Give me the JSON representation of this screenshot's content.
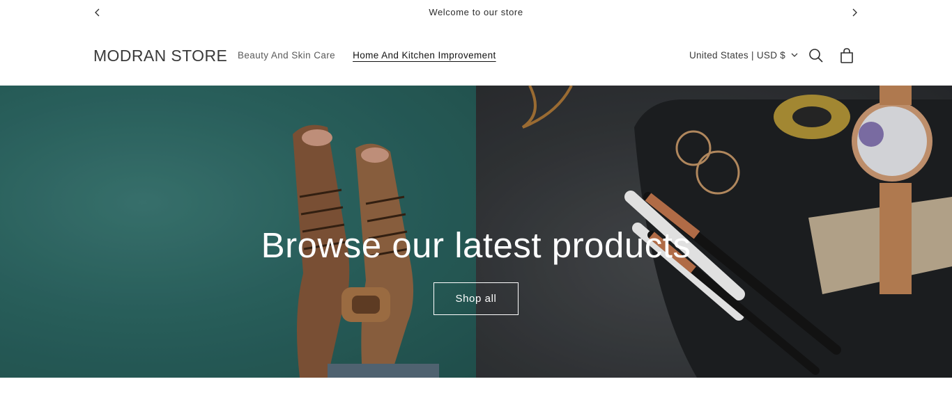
{
  "announcement": {
    "text": "Welcome to our store",
    "prev_icon": "chevron-left-icon",
    "next_icon": "chevron-right-icon"
  },
  "header": {
    "logo": "MODRAN STORE",
    "nav": [
      {
        "label": "Beauty And Skin Care",
        "active": false
      },
      {
        "label": "Home And Kitchen Improvement",
        "active": true
      }
    ],
    "localization": "United States | USD $",
    "icons": [
      "search-icon",
      "cart-icon",
      "chevron-down-icon"
    ]
  },
  "hero": {
    "title": "Browse our latest products",
    "button_label": "Shop all"
  },
  "colors": {
    "hero_left_bg": "#2e6b67",
    "hero_right_bg": "#35383b",
    "text": "#121212",
    "hero_text": "#ffffff"
  }
}
